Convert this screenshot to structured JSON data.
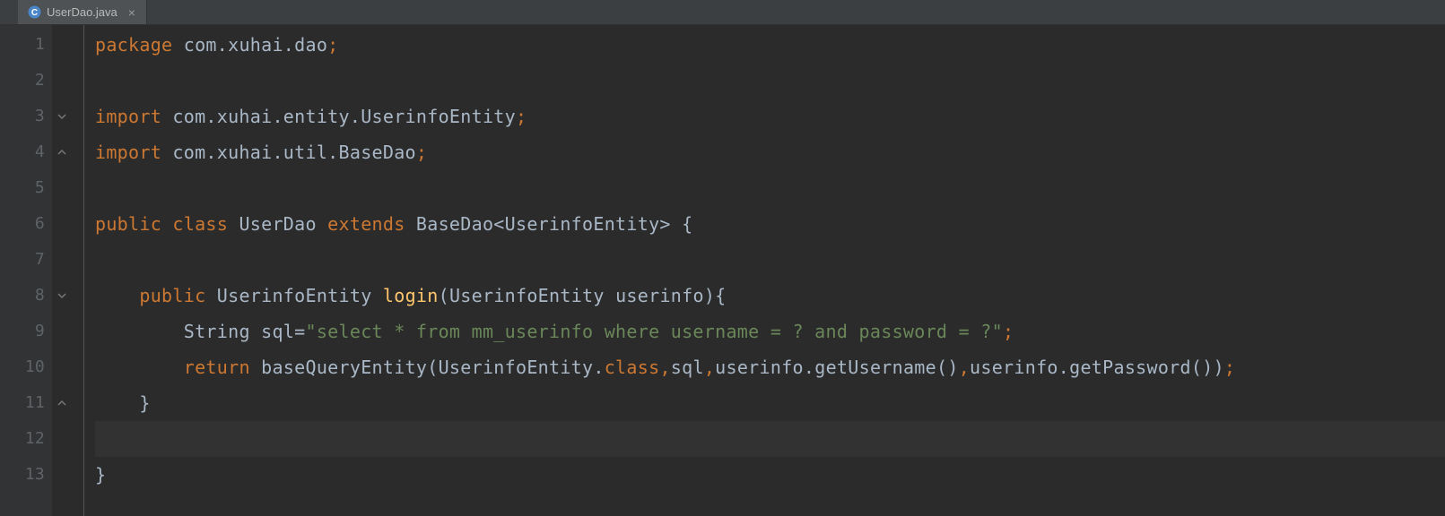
{
  "tab": {
    "filename": "UserDao.java",
    "close_glyph": "×"
  },
  "gutter": {
    "lines": [
      "1",
      "2",
      "3",
      "4",
      "5",
      "6",
      "7",
      "8",
      "9",
      "10",
      "11",
      "12",
      "13"
    ],
    "override_glyph": "@"
  },
  "code": {
    "l1": {
      "kw": "package ",
      "pkg": "com.xuhai.dao",
      "semi": ";"
    },
    "l3": {
      "kw": "import ",
      "pkg": "com.xuhai.entity.UserinfoEntity",
      "semi": ";"
    },
    "l4": {
      "kw": "import ",
      "pkg": "com.xuhai.util.BaseDao",
      "semi": ";"
    },
    "l6": {
      "kw1": "public class ",
      "name": "UserDao ",
      "kw2": "extends ",
      "base": "BaseDao",
      "lt": "<",
      "gen": "UserinfoEntity",
      "gt": ">",
      "sp": " ",
      "brace": "{"
    },
    "l8": {
      "indent": "    ",
      "kw": "public ",
      "ret": "UserinfoEntity ",
      "fn": "login",
      "open": "(",
      "ptype": "UserinfoEntity ",
      "pname": "userinfo",
      "close": ")",
      "brace": "{"
    },
    "l9": {
      "indent": "        ",
      "type": "String ",
      "var": "sql",
      "eq": "=",
      "str": "\"select * from mm_userinfo where username = ? and password = ?\"",
      "semi": ";"
    },
    "l10": {
      "indent": "        ",
      "kw": "return ",
      "fn": "baseQueryEntity",
      "open": "(",
      "arg1": "UserinfoEntity",
      "dot1": ".",
      "cls": "class",
      "comma1": ",",
      "arg2": "sql",
      "comma2": ",",
      "arg3": "userinfo",
      "dot2": ".",
      "m1": "getUsername",
      "p1": "()",
      "comma3": ",",
      "arg4": "userinfo",
      "dot3": ".",
      "m2": "getPassword",
      "p2": "()",
      "close": ")",
      "semi": ";"
    },
    "l11": {
      "indent": "    ",
      "brace": "}"
    },
    "l13": {
      "brace": "}"
    }
  }
}
